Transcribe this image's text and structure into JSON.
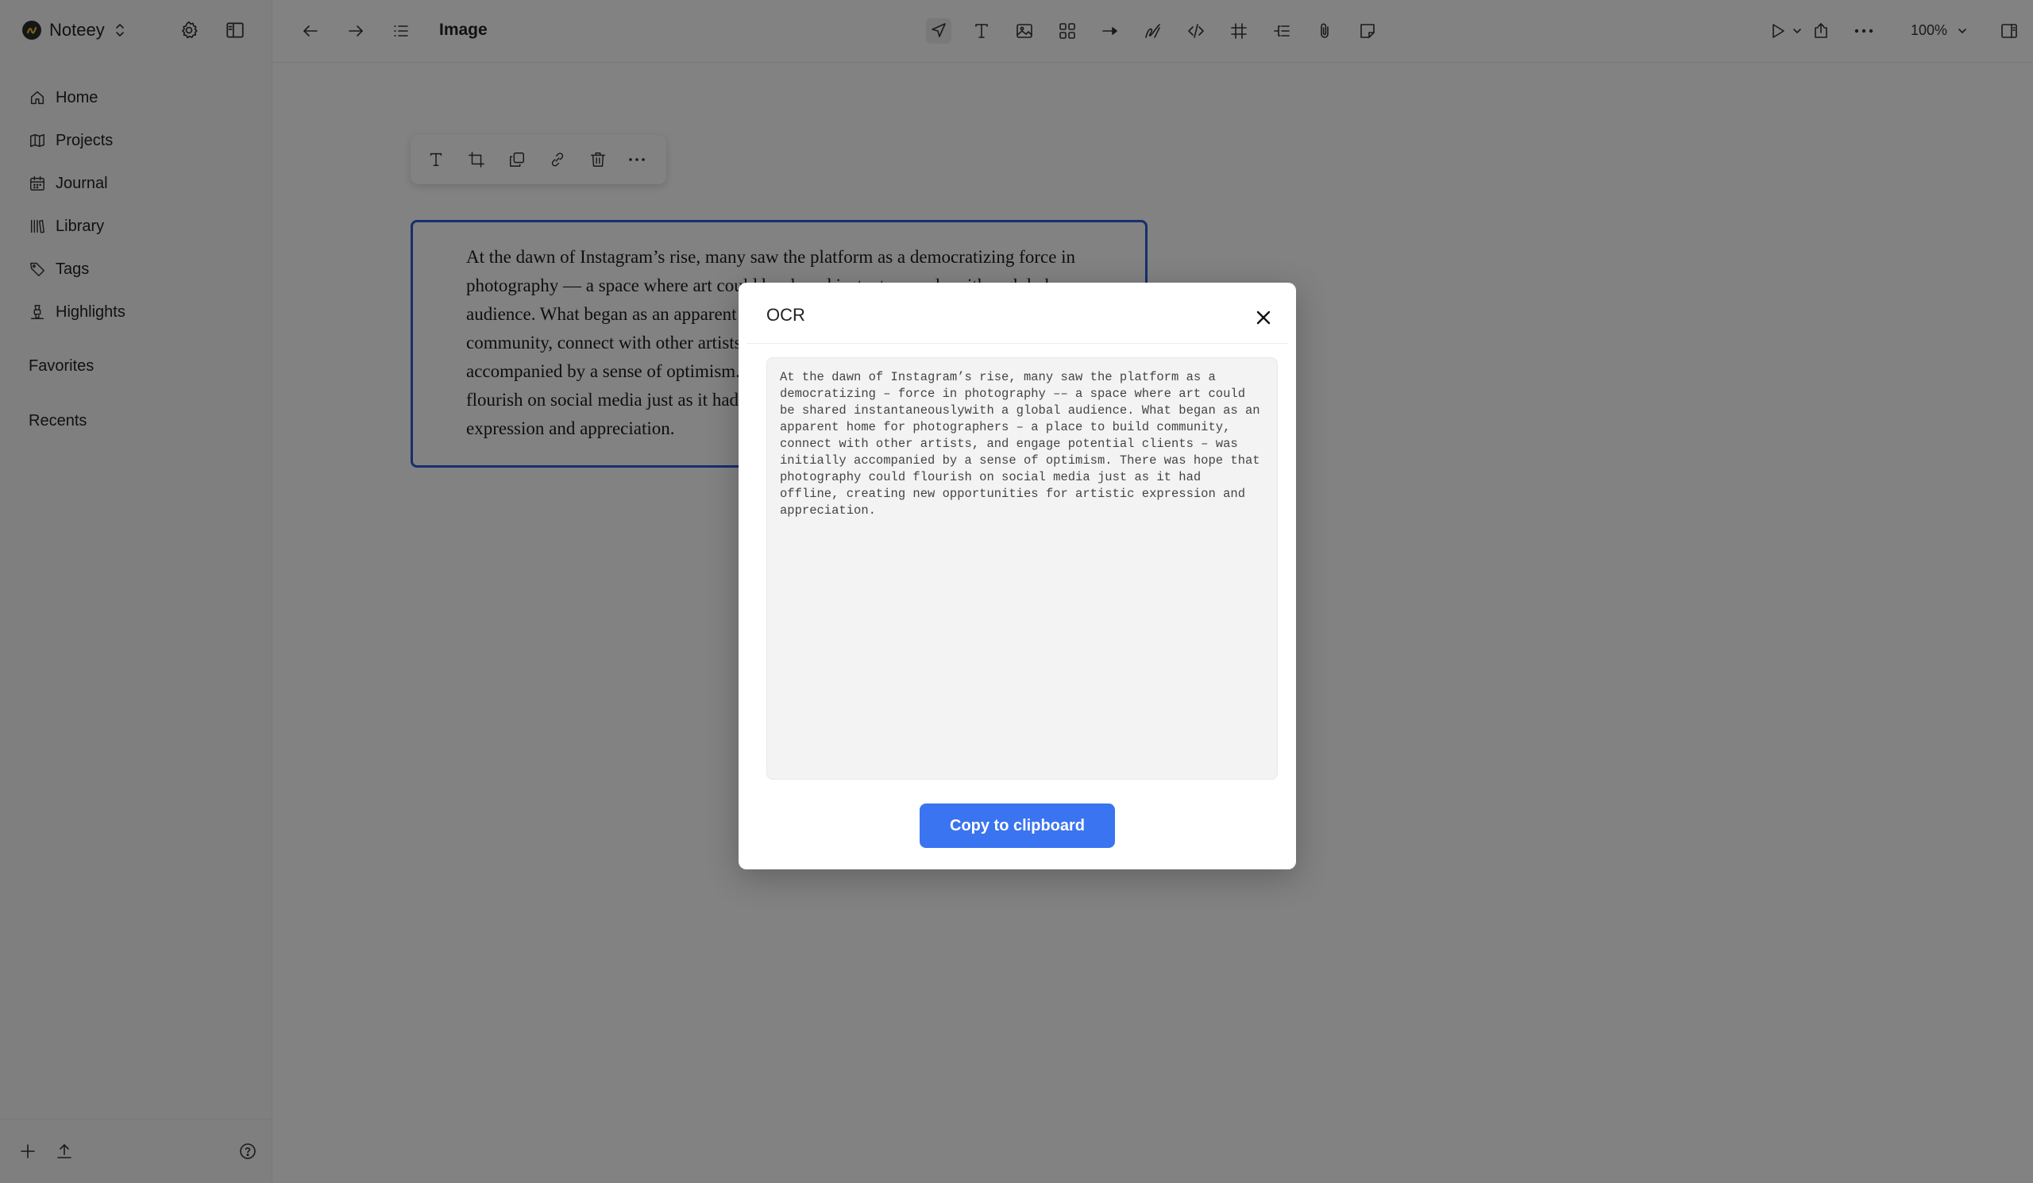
{
  "app": {
    "name": "Noteey"
  },
  "sidebar": {
    "items": [
      {
        "label": "Home",
        "icon": "home-icon"
      },
      {
        "label": "Projects",
        "icon": "map-icon"
      },
      {
        "label": "Journal",
        "icon": "calendar-icon"
      },
      {
        "label": "Library",
        "icon": "library-icon"
      },
      {
        "label": "Tags",
        "icon": "tag-icon"
      },
      {
        "label": "Highlights",
        "icon": "highlighter-icon"
      }
    ],
    "favorites_label": "Favorites",
    "recents_label": "Recents"
  },
  "toolbar": {
    "title": "Image",
    "zoom": "100%"
  },
  "canvas": {
    "image_text": "At the dawn of Instagram’s rise, many saw the platform as a democratizing force in photography — a space where art could be shared instantaneously with a global audience. What began as an apparent home for photographers — a place to build community, connect with other artists, and engage potential clients — was initially accompanied by a sense of optimism. There was hope that photography could flourish on social media just as it had offline, creating new opportunities for artistic expression and appreciation."
  },
  "modal": {
    "title": "OCR",
    "ocr_text": "At the dawn of Instagram’s rise, many saw the platform as a democratizing – force in photography –– a space where art could be shared instantaneouslywith a global audience. What began as an apparent home for photographers – a place to build community, connect with other artists, and engage potential clients – was initially accompanied by a sense of optimism. There was hope that photography could flourish on social media just as it had offline, creating new opportunities for artistic expression and appreciation.",
    "copy_button_label": "Copy to clipboard"
  },
  "colors": {
    "accent": "#3a74f0",
    "selection_border": "#2e5bdc",
    "overlay": "rgba(0,0,0,0.49)"
  }
}
